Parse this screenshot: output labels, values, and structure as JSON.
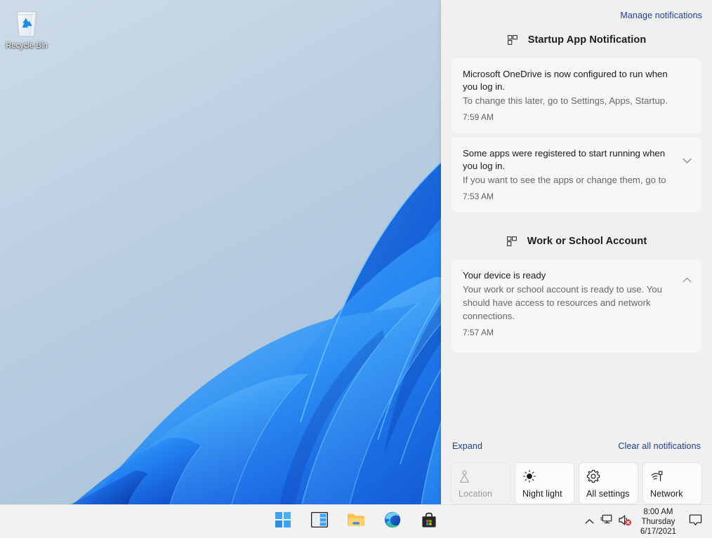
{
  "desktop": {
    "icons": [
      {
        "label": "Recycle Bin",
        "icon": "recycle-bin-icon"
      }
    ],
    "wallpaper_colors": {
      "sky_light": "#c9d8e6",
      "sky_mid": "#aec6dc",
      "bloom_bright": "#3ba5f7",
      "bloom_mid": "#1e7ced",
      "bloom_deep": "#0b3fc4",
      "bloom_dark": "#062a8f"
    }
  },
  "notification_center": {
    "manage_link": "Manage notifications",
    "groups": [
      {
        "title": "Startup App Notification",
        "icon": "windows-grid-icon",
        "notifications": [
          {
            "title": "Microsoft OneDrive is now configured to run when you log in.",
            "body": "To change this later, go to Settings, Apps, Startup.",
            "time": "7:59 AM",
            "chevron": null
          },
          {
            "title": "Some apps were registered to start running when you log in.",
            "body": "If you want to see the apps or change them, go to",
            "time": "7:53 AM",
            "chevron": "chevron-down-icon"
          }
        ]
      },
      {
        "title": "Work or School Account",
        "icon": "windows-grid-icon",
        "notifications": [
          {
            "title": "Your device is ready",
            "body": "Your work or school account is ready to use. You should have access to resources and network connections.",
            "time": "7:57 AM",
            "chevron": "chevron-up-icon"
          }
        ]
      }
    ],
    "expand_link": "Expand",
    "clear_all_link": "Clear all notifications",
    "quick_tiles": [
      {
        "label": "Location",
        "icon": "location-icon",
        "enabled": false
      },
      {
        "label": "Night light",
        "icon": "brightness-icon",
        "enabled": true
      },
      {
        "label": "All settings",
        "icon": "gear-icon",
        "enabled": true
      },
      {
        "label": "Network",
        "icon": "network-icon",
        "enabled": true
      }
    ]
  },
  "taskbar": {
    "buttons": [
      {
        "name": "start-button",
        "label": "Start",
        "icon": "windows-logo-icon"
      },
      {
        "name": "widgets-button",
        "label": "Widgets",
        "icon": "widgets-icon"
      },
      {
        "name": "file-explorer-button",
        "label": "File Explorer",
        "icon": "folder-icon"
      },
      {
        "name": "edge-button",
        "label": "Microsoft Edge",
        "icon": "edge-icon"
      },
      {
        "name": "store-button",
        "label": "Microsoft Store",
        "icon": "store-bag-icon"
      }
    ],
    "tray": {
      "overflow": {
        "label": "Show hidden icons",
        "icon": "chevron-up-icon"
      },
      "network": {
        "label": "Network",
        "icon": "ethernet-icon"
      },
      "volume": {
        "label": "Volume muted",
        "icon": "speaker-muted-icon"
      },
      "clock": {
        "time": "8:00 AM",
        "weekday": "Thursday",
        "date": "6/17/2021"
      },
      "notification_bell": {
        "label": "Notifications",
        "icon": "chat-bubble-icon"
      }
    }
  },
  "colors": {
    "link": "#1d3f8c",
    "panel_bg": "#f0f0f0",
    "card_bg": "#f7f7f7",
    "taskbar_bg": "#f2f2f2",
    "accent_blue": "#0078d4",
    "mute_badge_red": "#d13438"
  }
}
